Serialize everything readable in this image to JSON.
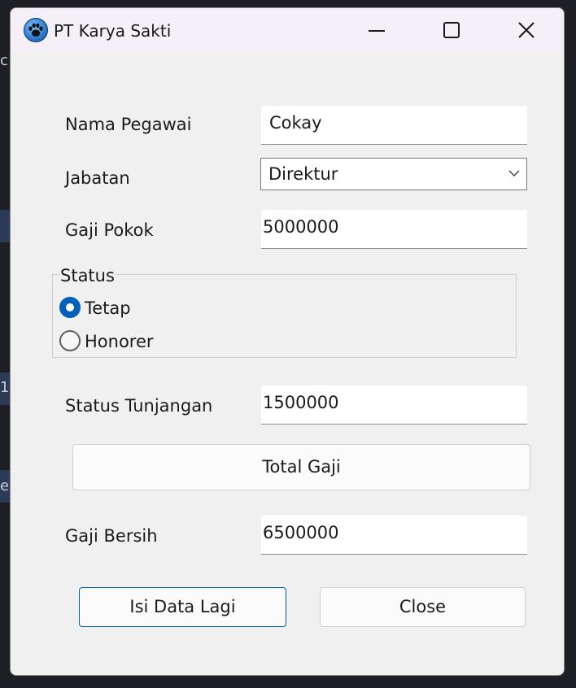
{
  "window": {
    "title": "PT Karya Sakti",
    "icon": "paw-icon"
  },
  "titlebar_buttons": {
    "minimize": "minimize-icon",
    "maximize": "maximize-icon",
    "close": "close-icon"
  },
  "form": {
    "nama_label": "Nama Pegawai",
    "nama_value": "Cokay",
    "jabatan_label": "Jabatan",
    "jabatan_value": "Direktur",
    "gaji_pokok_label": "Gaji Pokok",
    "gaji_pokok_value": "5000000",
    "status_group_title": "Status",
    "status_options": [
      {
        "label": "Tetap",
        "checked": true
      },
      {
        "label": "Honorer",
        "checked": false
      }
    ],
    "tunjangan_label": "Status Tunjangan",
    "tunjangan_value": "1500000",
    "total_button": "Total Gaji",
    "gaji_bersih_label": "Gaji Bersih",
    "gaji_bersih_value": "6500000"
  },
  "actions": {
    "isi_data_lagi": "Isi Data Lagi",
    "close": "Close"
  },
  "background": {
    "fragments": [
      "c",
      "1",
      "e"
    ]
  },
  "colors": {
    "accent": "#005fb8",
    "window_bg": "#f0f0f0",
    "titlebar_bg": "#f5f0f7"
  }
}
